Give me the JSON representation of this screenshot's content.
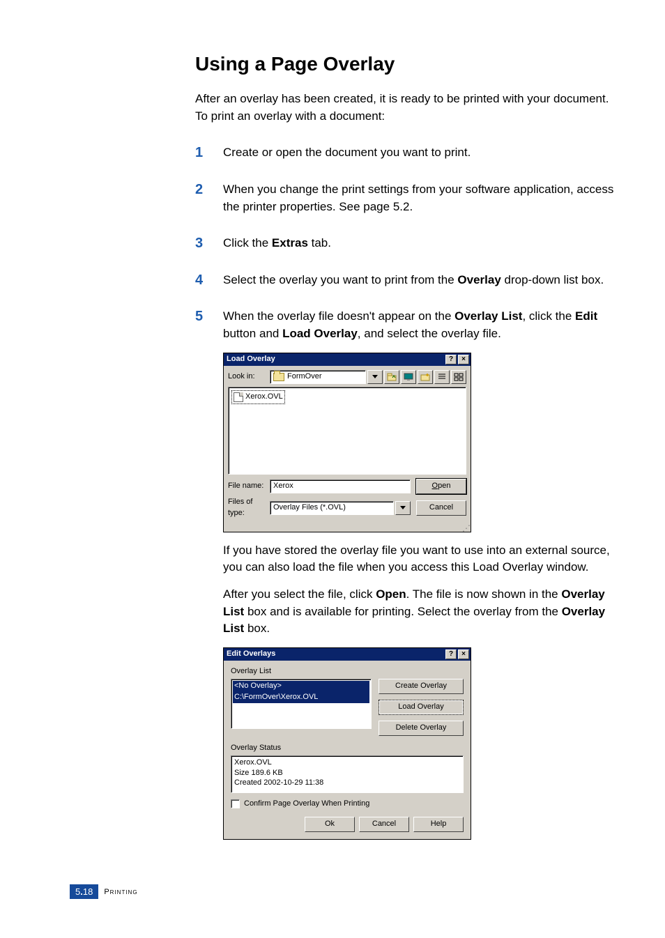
{
  "heading": "Using a Page Overlay",
  "intro": "After an overlay has been created, it is ready to be printed with your document. To print an overlay with a document:",
  "steps": {
    "s1": "Create or open the document you want to print.",
    "s2": "When you change the print settings from your software application, access the printer properties. See page 5.2.",
    "s3_a": "Click the ",
    "s3_b": "Extras",
    "s3_c": " tab.",
    "s4_a": "Select the overlay you want to print from the ",
    "s4_b": "Overlay",
    "s4_c": " drop-down list box.",
    "s5_a": "When the overlay file doesn't appear on the ",
    "s5_b": "Overlay List",
    "s5_c": ", click the ",
    "s5_d": "Edit",
    "s5_e": " button and ",
    "s5_f": "Load Overlay",
    "s5_g": ", and select the overlay file.",
    "s5_p2": "If you have stored the overlay file you want to use into an external source, you can also load the file when you access this Load Overlay window.",
    "s5_p3_a": "After you select the file, click ",
    "s5_p3_b": "Open",
    "s5_p3_c": ". The file is now shown in the ",
    "s5_p3_d": "Overlay List",
    "s5_p3_e": " box and is available for printing. Select the overlay from the ",
    "s5_p3_f": "Overlay List",
    "s5_p3_g": " box."
  },
  "nums": {
    "n1": "1",
    "n2": "2",
    "n3": "3",
    "n4": "4",
    "n5": "5"
  },
  "load_overlay": {
    "title": "Load Overlay",
    "look_in_label": "Look in:",
    "look_in_value": "FormOver",
    "file_item": "Xerox.OVL",
    "file_name_label": "File name:",
    "file_name_value": "Xerox",
    "file_type_label": "Files of type:",
    "file_type_value": "Overlay Files (*.OVL)",
    "open_btn": "Open",
    "cancel_btn": "Cancel"
  },
  "edit_overlays": {
    "title": "Edit Overlays",
    "list_label": "Overlay List",
    "item0": "<No Overlay>",
    "item1": "C:\\FormOver\\Xerox.OVL",
    "create_btn": "Create Overlay",
    "load_btn": "Load Overlay",
    "delete_btn": "Delete Overlay",
    "status_label": "Overlay Status",
    "status_line1": "Xerox.OVL",
    "status_line2": "Size 189.6 KB",
    "status_line3": "Created 2002-10-29 11:38",
    "confirm": "Confirm Page Overlay When Printing",
    "ok": "Ok",
    "cancel": "Cancel",
    "help": "Help"
  },
  "footer": {
    "chapter": "5",
    "dot": ".",
    "page": "18",
    "section": "Printing"
  }
}
